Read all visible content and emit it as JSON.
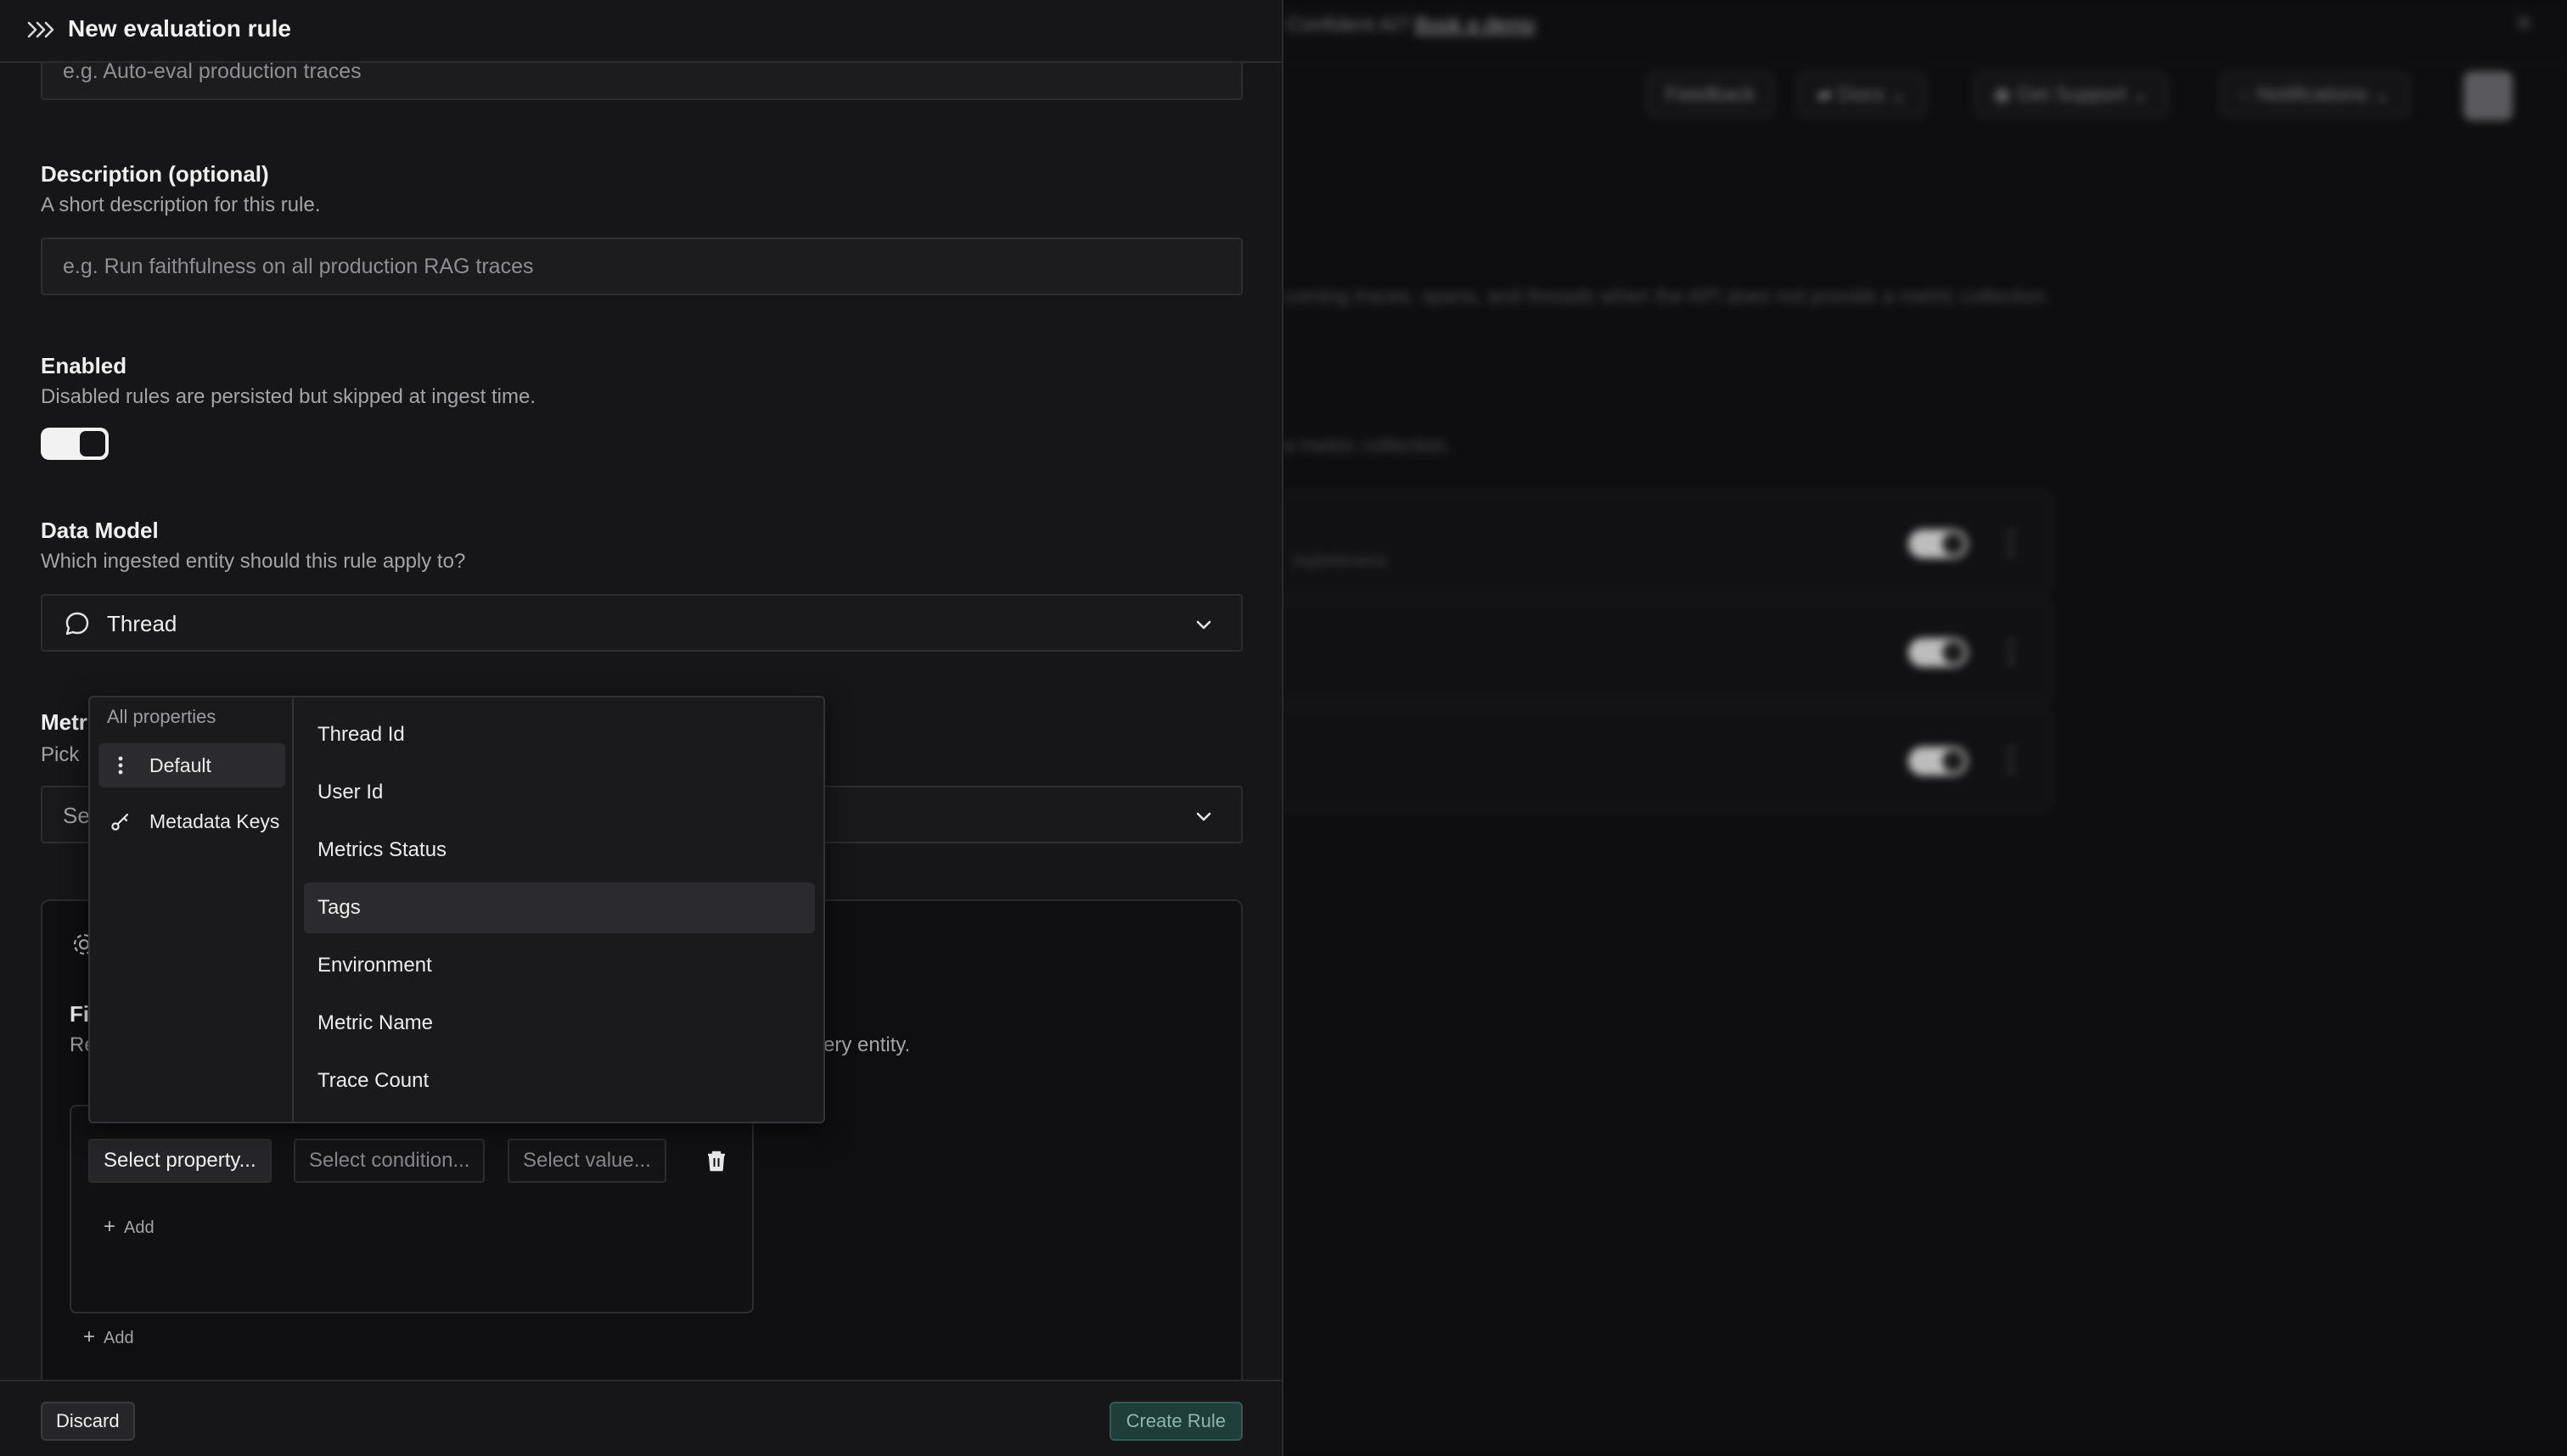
{
  "background": {
    "announcement_text": "Confident AI?",
    "announcement_link": "Book a demo",
    "buttons": [
      "Feedback",
      "Docs",
      "Get Support",
      "Notifications"
    ],
    "desc_line_1": "coming traces, spans, and threads when the API does not provide a metric collection.",
    "desc_line_2": "a metric collection.",
    "card_1_sub": "mpleteness"
  },
  "panel": {
    "title": "New evaluation rule",
    "name_placeholder": "e.g. Auto-eval production traces",
    "description": {
      "label": "Description (optional)",
      "hint": "A short description for this rule.",
      "placeholder": "e.g. Run faithfulness on all production RAG traces"
    },
    "enabled": {
      "label": "Enabled",
      "hint": "Disabled rules are persisted but skipped at ingest time.",
      "value": true
    },
    "data_model": {
      "label": "Data Model",
      "hint": "Which ingested entity should this rule apply to?",
      "selected": "Thread"
    },
    "metric": {
      "label_visible": "Metr",
      "hint_visible": "Pick",
      "placeholder_visible": "Se"
    },
    "filters": {
      "title_visible": "Fi",
      "desc_visible_start": "Re",
      "desc_visible_end": "ery entity.",
      "select_property": "Select property...",
      "select_condition": "Select condition...",
      "select_value": "Select value...",
      "add_inner": "Add",
      "add_outer": "Add"
    },
    "footer": {
      "discard": "Discard",
      "create": "Create Rule"
    }
  },
  "property_menu": {
    "header": "All properties",
    "categories": [
      {
        "label": "Default",
        "icon": "kebab-icon",
        "active": true
      },
      {
        "label": "Metadata Keys",
        "icon": "key-icon",
        "active": false
      }
    ],
    "properties": [
      "Thread Id",
      "User Id",
      "Metrics Status",
      "Tags",
      "Environment",
      "Metric Name",
      "Trace Count"
    ],
    "highlighted": "Tags"
  }
}
